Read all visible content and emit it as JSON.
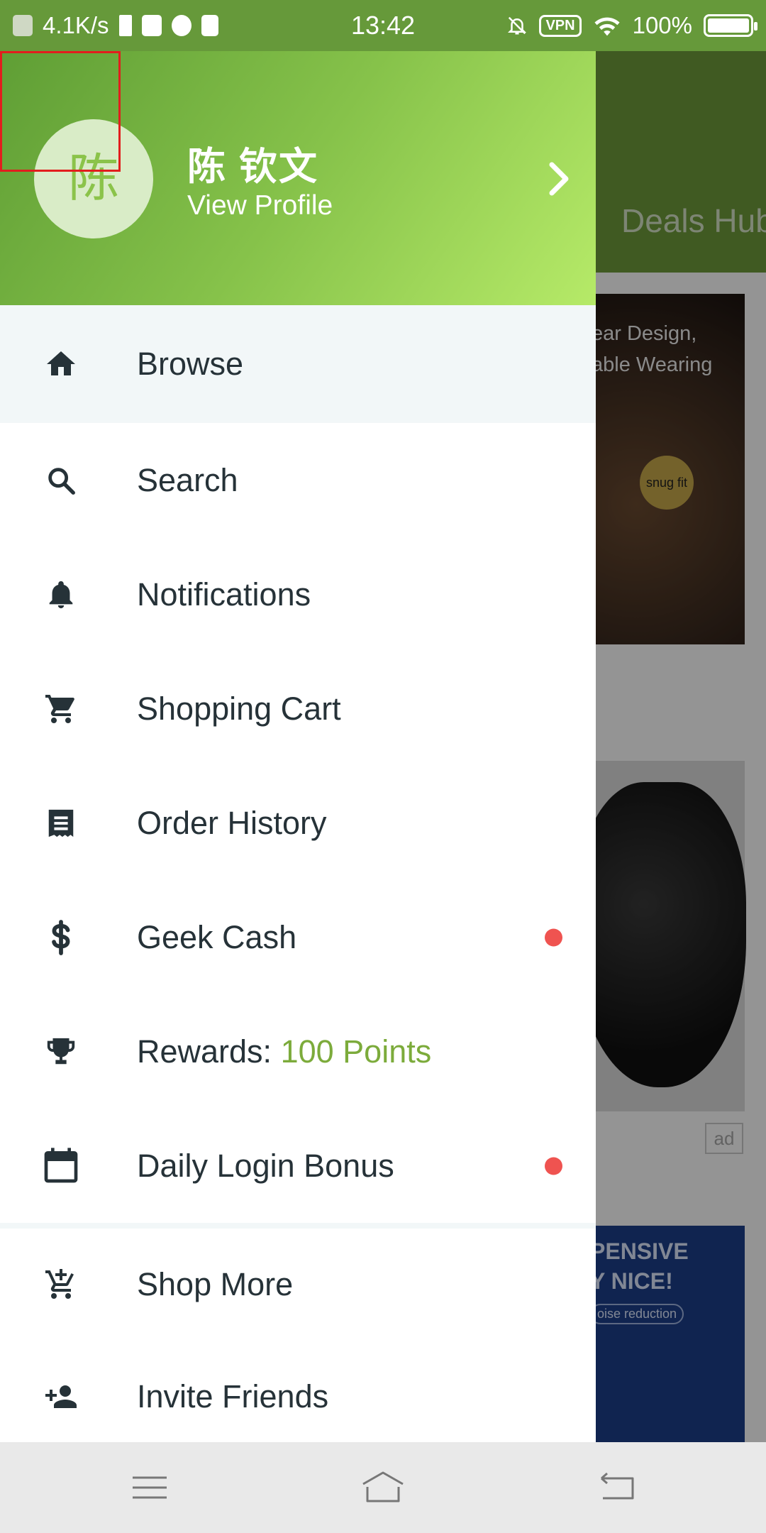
{
  "status_bar": {
    "net_speed": "4.1K/s",
    "time": "13:42",
    "vpn": "VPN",
    "battery": "100%"
  },
  "background_app": {
    "tab_label": "Deals Hub",
    "banner_line1": "ear Design,",
    "banner_line2": "able Wearing",
    "banner_badge": "snug fit",
    "ad_label": "ad",
    "banner2_line1": "PENSIVE",
    "banner2_line2": "Y NICE!",
    "banner2_line3": "oise reduction"
  },
  "drawer": {
    "avatar_char": "陈",
    "user_name": "陈 钦文",
    "view_profile": "View Profile",
    "menu": {
      "browse": "Browse",
      "search": "Search",
      "notifications": "Notifications",
      "cart": "Shopping Cart",
      "orders": "Order History",
      "geek_cash": "Geek Cash",
      "rewards_prefix": "Rewards: ",
      "rewards_points": "100 Points",
      "daily_bonus": "Daily Login Bonus",
      "shop_more": "Shop More",
      "invite": "Invite Friends"
    }
  },
  "colors": {
    "brand_green": "#7cab3b",
    "badge_red": "#ef5350",
    "active_bg": "#f2f7f8"
  }
}
